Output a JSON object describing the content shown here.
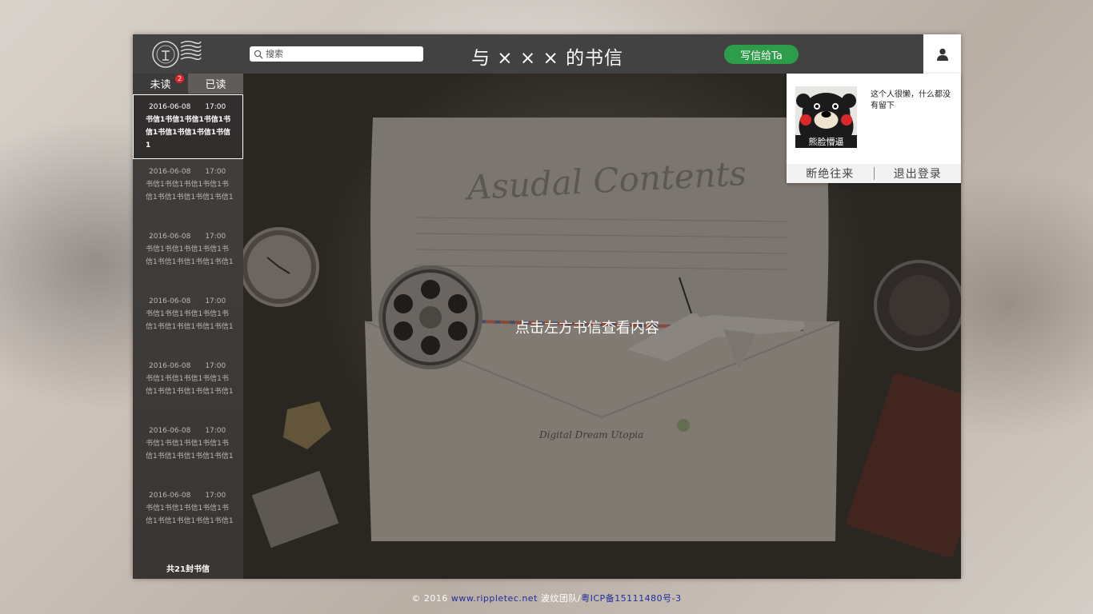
{
  "header": {
    "title": "与 × × × 的书信",
    "search_placeholder": "搜索",
    "write_button": "写信给Ta"
  },
  "sidebar": {
    "tabs": [
      {
        "label": "未读",
        "badge": "2"
      },
      {
        "label": "已读"
      }
    ],
    "letters": [
      {
        "date": "2016-06-08",
        "time": "17:00",
        "preview": "书信1书信1书信1书信1书信1书信1书信1书信1书信1"
      },
      {
        "date": "2016-06-08",
        "time": "17:00",
        "preview": "书信1书信1书信1书信1书信1书信1书信1书信1书信1"
      },
      {
        "date": "2016-06-08",
        "time": "17:00",
        "preview": "书信1书信1书信1书信1书信1书信1书信1书信1书信1"
      },
      {
        "date": "2016-06-08",
        "time": "17:00",
        "preview": "书信1书信1书信1书信1书信1书信1书信1书信1书信1"
      },
      {
        "date": "2016-06-08",
        "time": "17:00",
        "preview": "书信1书信1书信1书信1书信1书信1书信1书信1书信1"
      },
      {
        "date": "2016-06-08",
        "time": "17:00",
        "preview": "书信1书信1书信1书信1书信1书信1书信1书信1书信1"
      },
      {
        "date": "2016-06-08",
        "time": "17:00",
        "preview": "书信1书信1书信1书信1书信1书信1书信1书信1书信1"
      }
    ],
    "total": "共21封书信"
  },
  "main": {
    "prompt": "点击左方书信查看内容",
    "envelope_script": "Asudal Contents",
    "envelope_footer": "Digital Dream Utopia"
  },
  "popup": {
    "avatar_caption": "熊脸懵逼",
    "bio": "这个人很懒，什么都没有留下",
    "block_action": "断绝往来",
    "logout_action": "退出登录"
  },
  "footer": {
    "copyright": "© 2016",
    "site_link": "www.rippletec.net",
    "team": "波纹团队/",
    "icp_link": "粤ICP备15111480号-3"
  },
  "colors": {
    "header_bg": "#424242",
    "accent_green": "#2e9d4b",
    "badge_red": "#e0262c",
    "footer_link": "#1f2f9e"
  }
}
